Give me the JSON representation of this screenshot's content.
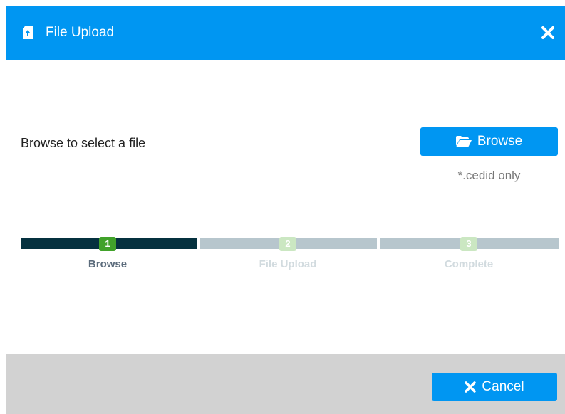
{
  "dialog": {
    "title": "File Upload",
    "title_icon": "file-upload-icon",
    "close_icon": "close-icon"
  },
  "upload": {
    "prompt": "Browse to select a file",
    "browse_label": "Browse",
    "browse_icon": "folder-open-icon",
    "hint": "*.cedid only"
  },
  "steps": [
    {
      "number": "1",
      "label": "Browse",
      "state": "active"
    },
    {
      "number": "2",
      "label": "File Upload",
      "state": "pending"
    },
    {
      "number": "3",
      "label": "Complete",
      "state": "pending"
    }
  ],
  "footer": {
    "cancel_label": "Cancel",
    "cancel_icon": "close-icon"
  },
  "colors": {
    "accent": "#0096f2",
    "step_active_bar": "#05313f",
    "step_pending_bar": "#b7c6cd",
    "step_active_badge": "#41a22a",
    "step_pending_badge": "#cbe7c2",
    "footer_bg": "#d2d2d2"
  }
}
